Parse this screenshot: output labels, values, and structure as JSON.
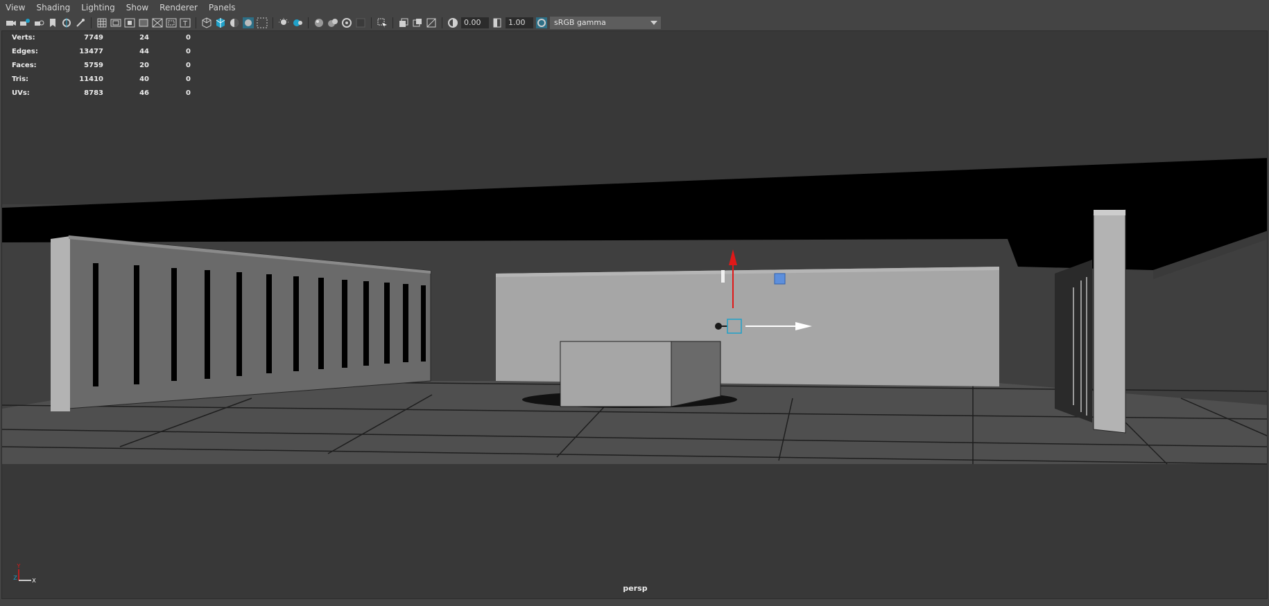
{
  "menu": [
    "View",
    "Shading",
    "Lighting",
    "Show",
    "Renderer",
    "Panels"
  ],
  "toolbar": {
    "exposure_value": "0.00",
    "gamma_value": "1.00",
    "color_space": "sRGB gamma",
    "icons": [
      "camera-icon",
      "camera-attributes-icon",
      "bookmark-icon",
      "image-plane-icon",
      "grid-icon",
      "film-gate-icon",
      "resolution-gate-icon",
      "gate-mask-icon",
      "field-chart-icon",
      "safe-action-icon",
      "safe-title-icon",
      "wireframe-icon",
      "smooth-shade-icon",
      "textured-icon",
      "use-all-lights-icon",
      "shadows-icon",
      "ambient-occlusion-icon",
      "motion-blur-icon",
      "multisample-aa-icon",
      "depth-of-field-icon",
      "isolate-select-icon",
      "xray-icon",
      "xray-joints-icon",
      "xray-active-components-icon",
      "backface-culling-icon",
      "exposure-icon",
      "gamma-icon",
      "color-management-icon"
    ]
  },
  "hud": {
    "rows": [
      {
        "label": "Verts:",
        "v1": "7749",
        "v2": "24",
        "v3": "0"
      },
      {
        "label": "Edges:",
        "v1": "13477",
        "v2": "44",
        "v3": "0"
      },
      {
        "label": "Faces:",
        "v1": "5759",
        "v2": "20",
        "v3": "0"
      },
      {
        "label": "Tris:",
        "v1": "11410",
        "v2": "40",
        "v3": "0"
      },
      {
        "label": "UVs:",
        "v1": "8783",
        "v2": "46",
        "v3": "0"
      }
    ]
  },
  "axis": {
    "y_label": "Y",
    "z_label": "Z",
    "x_label": "X"
  },
  "camera_label": "persp",
  "colors": {
    "viewport_bg": "#383838",
    "ceiling": "#000000",
    "floor": "#4f4f4f",
    "wall_panel": "#a6a6a6",
    "accent_blue": "#1fa0c8",
    "manip_y": "#e01818",
    "manip_x": "#ffffff"
  }
}
